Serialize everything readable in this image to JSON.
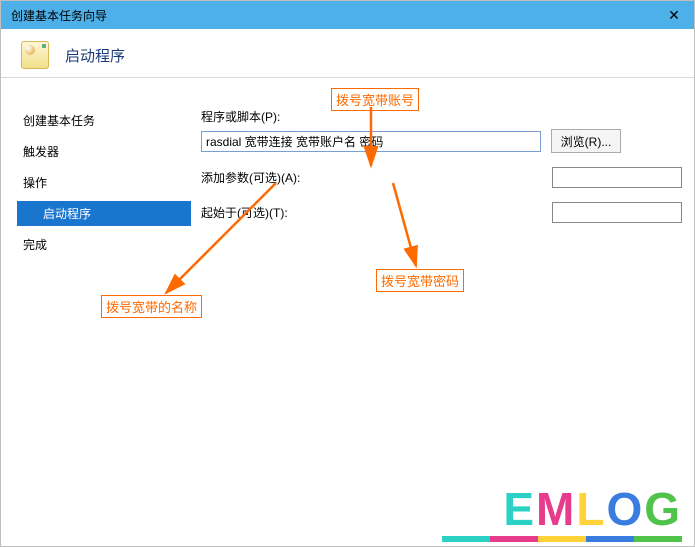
{
  "titlebar": {
    "title": "创建基本任务向导"
  },
  "header": {
    "title": "启动程序"
  },
  "sidebar": {
    "items": [
      {
        "label": "创建基本任务"
      },
      {
        "label": "触发器"
      },
      {
        "label": "操作"
      },
      {
        "label": "启动程序",
        "active": true
      },
      {
        "label": "完成"
      }
    ]
  },
  "form": {
    "program_label": "程序或脚本(P):",
    "program_value": "rasdial 宽带连接 宽带账户名 密码",
    "browse_label": "浏览(R)...",
    "args_label": "添加参数(可选)(A):",
    "args_value": "",
    "startin_label": "起始于(可选)(T):",
    "startin_value": ""
  },
  "annotations": {
    "account": "拨号宽带账号",
    "password": "拨号宽带密码",
    "name": "拨号宽带的名称"
  },
  "logo": {
    "chars": [
      "E",
      "M",
      "L",
      "O",
      "G"
    ]
  }
}
